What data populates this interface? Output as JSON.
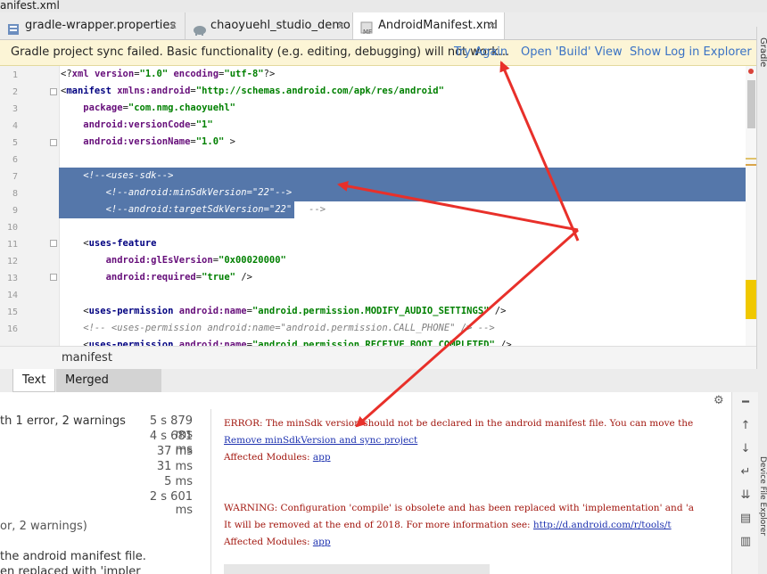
{
  "window": {
    "title": "anifest.xml"
  },
  "tabs": [
    {
      "label": "gradle-wrapper.properties",
      "icon": "properties-file-icon"
    },
    {
      "label": "chaoyuehl_studio_demo",
      "icon": "elephant-icon"
    },
    {
      "label": "AndroidManifest.xml",
      "icon": "manifest-file-icon",
      "active": true
    }
  ],
  "banner": {
    "message": "Gradle project sync failed. Basic functionality (e.g. editing, debugging) will not work...",
    "try_again": "Try Again",
    "open_build": "Open 'Build' View",
    "show_log": "Show Log in Explorer"
  },
  "right_strip": {
    "label": "Gradle"
  },
  "editor": {
    "line_numbers": [
      "1",
      "2",
      "3",
      "4",
      "5",
      "6",
      "7",
      "8",
      "9",
      "10",
      "11",
      "12",
      "13",
      "14",
      "15",
      "16"
    ]
  },
  "breadcrumb": {
    "label": "manifest"
  },
  "bottom_tabs": {
    "text": "Text",
    "merged": "Merged Manifest"
  },
  "build_tree": [
    {
      "label": "th 1 error, 2 warnings",
      "time": "5 s 879 ms"
    },
    {
      "label": "",
      "time": "4 s 681 ms"
    },
    {
      "label": "",
      "time": "37 ms"
    },
    {
      "label": "",
      "time": "31 ms"
    },
    {
      "label": "",
      "time": "5 ms"
    },
    {
      "label": "",
      "time": "2 s 601 ms"
    }
  ],
  "build_tree_extra": {
    "warnings": "or, 2 warnings)",
    "line1": "the android manifest file.",
    "line2": "en replaced with 'impler"
  },
  "build_output": {
    "error": "ERROR: The minSdk version should not be declared in the android manifest file. You can move the",
    "fix_link": "Remove minSdkVersion and sync project",
    "affected1_label": "Affected Modules: ",
    "affected1_link": "app",
    "warning": "WARNING: Configuration 'compile' is obsolete and has been replaced with 'implementation' and 'a",
    "removed_prefix": "It will be removed at the end of 2018. For more information see: ",
    "removed_link": "http://d.android.com/r/tools/t",
    "affected2_label": "Affected Modules: ",
    "affected2_link": "app"
  },
  "device_explorer": {
    "label": "Device File Explorer"
  },
  "colors": {
    "selection": "#5577aa",
    "banner": "#fcf5d6",
    "link": "#3a72c4",
    "arrow": "#e8302a"
  }
}
